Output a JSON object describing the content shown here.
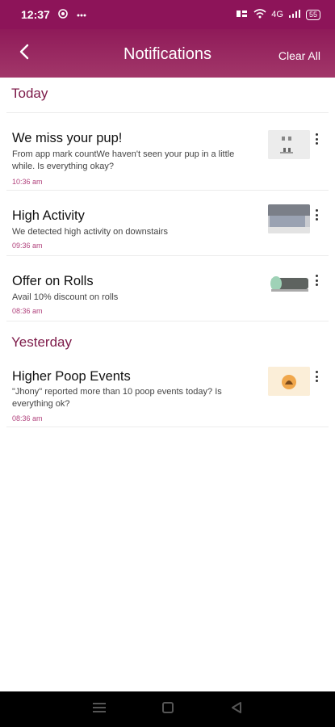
{
  "status_bar": {
    "time": "12:37",
    "signal_text": "4G",
    "battery": "55"
  },
  "header": {
    "title": "Notifications",
    "clear_all_label": "Clear All",
    "back_icon": "chevron-left-icon"
  },
  "sections": [
    {
      "label": "Today",
      "items": [
        {
          "title": "We miss your pup!",
          "body": "From app mark countWe haven't seen your pup in a little while. Is everything okay?",
          "time": "10:36 am",
          "thumb": "pup-thumbnail"
        },
        {
          "title": "High Activity",
          "body": "We detected high activity on downstairs",
          "time": "09:36 am",
          "thumb": "room-thumbnail"
        },
        {
          "title": "Offer on Rolls",
          "body": "Avail 10% discount on rolls",
          "time": "08:36 am",
          "thumb": "roll-thumbnail"
        }
      ]
    },
    {
      "label": "Yesterday",
      "items": [
        {
          "title": "Higher Poop Events",
          "body": "\"Jhony\" reported more than 10 poop events today? Is everything ok?",
          "time": "08:36 am",
          "thumb": "poop-thumbnail"
        }
      ]
    }
  ],
  "colors": {
    "brand": "#8d1459",
    "section_label": "#7d1a49",
    "timestamp": "#b1437d"
  }
}
